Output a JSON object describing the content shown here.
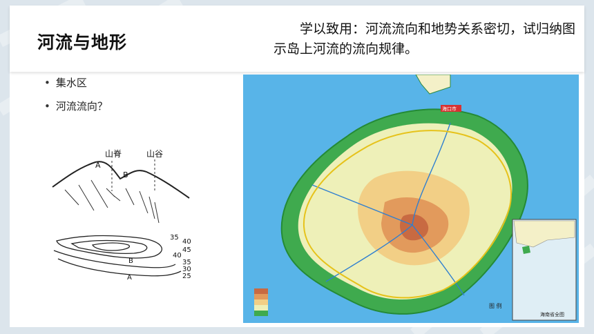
{
  "slide": {
    "title": "河流与地形",
    "question": "　　学以致用：河流流向和地势关系密切，试归纳图示岛上河流的流向规律。",
    "bullets": [
      "集水区",
      "河流流向？"
    ]
  },
  "terrain_diagram": {
    "ridge_label": "山脊",
    "valley_label": "山谷",
    "point_a": "A",
    "point_b": "B",
    "contour_labels": [
      "35",
      "40",
      "45",
      "40",
      "35",
      "30",
      "25"
    ]
  },
  "map": {
    "capital_label": "海口市",
    "legend_title": "图 例",
    "inset_title": "海南省全图"
  },
  "colors": {
    "sea": "#58b4e8",
    "lowland": "#3faa4e",
    "plain": "#eef0b8",
    "hill": "#f2cf86",
    "mountain": "#e29a5c",
    "peak": "#c86a42",
    "inset_bg": "#dfeef5"
  }
}
